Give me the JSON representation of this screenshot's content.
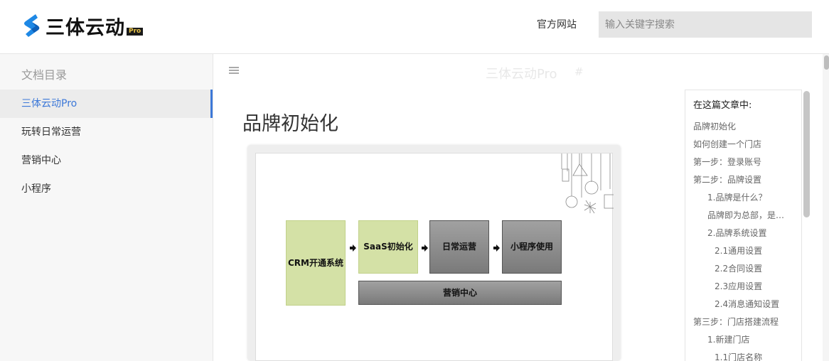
{
  "header": {
    "logo_text": "三体云动",
    "logo_badge": "Pro",
    "official_site_label": "官方网站",
    "search_placeholder": "输入关键字搜索"
  },
  "sidebar": {
    "title": "文档目录",
    "items": [
      {
        "label": "三体云动Pro",
        "active": true
      },
      {
        "label": "玩转日常运营",
        "active": false
      },
      {
        "label": "营销中心",
        "active": false
      },
      {
        "label": "小程序",
        "active": false
      }
    ]
  },
  "main": {
    "top_title": "三体云动Pro",
    "top_anchor": "#",
    "page_title": "品牌初始化",
    "diagram": {
      "box_crm": "CRM开通系统",
      "box_saas": "SaaS初始化",
      "box_daily": "日常运营",
      "box_miniapp": "小程序使用",
      "box_marketing": "营销中心"
    }
  },
  "toc": {
    "heading": "在这篇文章中:",
    "items": [
      "品牌初始化",
      "如何创建一个门店",
      "第一步：登录账号",
      "第二步：品牌设置",
      "1.品牌是什么？",
      "品牌即为总部，是…",
      "2.品牌系统设置",
      "2.1通用设置",
      "2.2合同设置",
      "2.3应用设置",
      "2.4消息通知设置",
      "第三步：门店搭建流程",
      "1.新建门店",
      "1.1门店名称"
    ]
  },
  "colors": {
    "accent": "#3c78d8",
    "logo_blue": "#1e88e5",
    "diagram_green": "#d4e1a6",
    "diagram_gray": "#8a8a8a"
  }
}
